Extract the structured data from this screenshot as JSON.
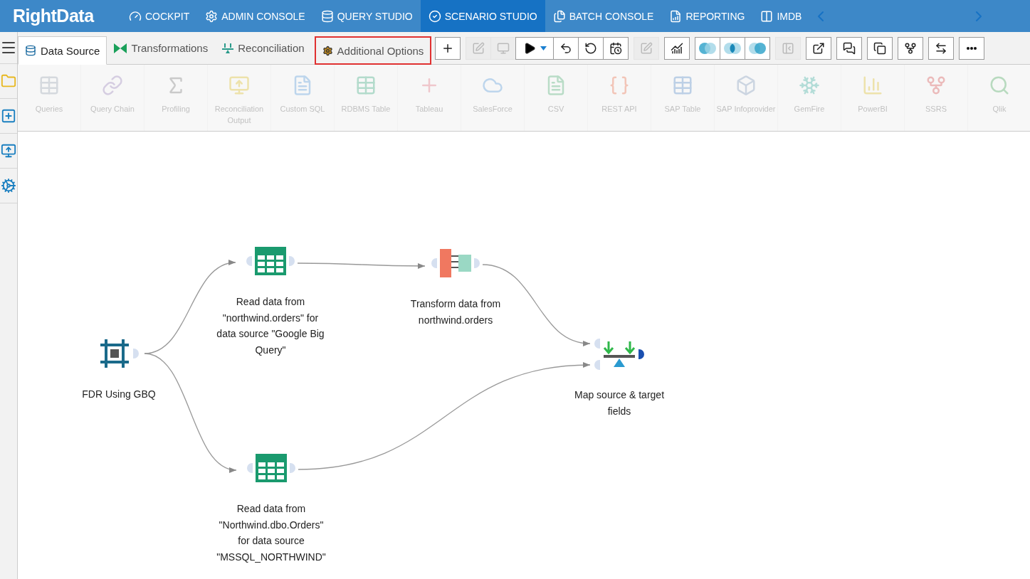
{
  "logo": "RightData",
  "nav": [
    {
      "label": "COCKPIT",
      "kind": "gauge",
      "selected": false
    },
    {
      "label": "ADMIN CONSOLE",
      "kind": "gear",
      "selected": false
    },
    {
      "label": "QUERY STUDIO",
      "kind": "database",
      "selected": false
    },
    {
      "label": "SCENARIO STUDIO",
      "kind": "scenario",
      "selected": true
    },
    {
      "label": "BATCH CONSOLE",
      "kind": "files",
      "selected": false
    },
    {
      "label": "REPORTING",
      "kind": "report",
      "selected": false
    },
    {
      "label": "IMDB",
      "kind": "columns",
      "selected": false
    }
  ],
  "tabs": [
    {
      "label": "Data Source",
      "kind": "source",
      "selected": true,
      "highlighted": false
    },
    {
      "label": "Transformations",
      "kind": "transform",
      "selected": false,
      "highlighted": false
    },
    {
      "label": "Reconciliation",
      "kind": "recon",
      "selected": false,
      "highlighted": false
    },
    {
      "label": "Additional Options",
      "kind": "options",
      "selected": false,
      "highlighted": true
    }
  ],
  "toolbar_groups": [
    [
      {
        "kind": "add",
        "disabled": false
      }
    ],
    [
      {
        "kind": "edit",
        "disabled": true
      },
      {
        "kind": "monitor",
        "disabled": true
      },
      {
        "kind": "run",
        "disabled": false
      },
      {
        "kind": "undo",
        "disabled": false
      },
      {
        "kind": "history",
        "disabled": false
      },
      {
        "kind": "schedule",
        "disabled": false
      }
    ],
    [
      {
        "kind": "edit",
        "disabled": true
      }
    ],
    [
      {
        "kind": "chart",
        "disabled": false
      }
    ],
    [
      {
        "kind": "venn-left",
        "disabled": false
      },
      {
        "kind": "venn-inner",
        "disabled": false
      },
      {
        "kind": "venn-right",
        "disabled": false
      }
    ],
    [
      {
        "kind": "collapse",
        "disabled": true
      }
    ],
    [
      {
        "kind": "export",
        "disabled": false
      }
    ],
    [
      {
        "kind": "comment",
        "disabled": false
      }
    ],
    [
      {
        "kind": "copy",
        "disabled": false
      }
    ],
    [
      {
        "kind": "flow",
        "disabled": false
      }
    ],
    [
      {
        "kind": "compare",
        "disabled": false
      }
    ],
    [
      {
        "kind": "more",
        "disabled": false
      }
    ]
  ],
  "palette": [
    {
      "label": "Queries",
      "kind": "queries",
      "disabled": true
    },
    {
      "label": "Query Chain",
      "kind": "chain",
      "disabled": true
    },
    {
      "label": "Profiling",
      "kind": "profiling",
      "disabled": true
    },
    {
      "label": "Reconciliation Output",
      "kind": "recon",
      "disabled": true
    },
    {
      "label": "Custom SQL",
      "kind": "sql",
      "disabled": true
    },
    {
      "label": "RDBMS Table",
      "kind": "table",
      "disabled": true
    },
    {
      "label": "Tableau",
      "kind": "tableau",
      "disabled": true
    },
    {
      "label": "SalesForce",
      "kind": "cloud",
      "disabled": true
    },
    {
      "label": "CSV",
      "kind": "csv",
      "disabled": true
    },
    {
      "label": "REST API",
      "kind": "rest",
      "disabled": true
    },
    {
      "label": "SAP Table",
      "kind": "sap",
      "disabled": true
    },
    {
      "label": "SAP Infoprovider",
      "kind": "cube",
      "disabled": true
    },
    {
      "label": "GemFire",
      "kind": "gemfire",
      "disabled": true
    },
    {
      "label": "PowerBI",
      "kind": "powerbi",
      "disabled": true
    },
    {
      "label": "SSRS",
      "kind": "ssrs",
      "disabled": true
    },
    {
      "label": "Qlik",
      "kind": "qlik",
      "disabled": true
    }
  ],
  "sidebar": [
    {
      "kind": "folder"
    },
    {
      "kind": "add-source"
    },
    {
      "kind": "monitor"
    },
    {
      "kind": "settings"
    }
  ],
  "nodes": [
    {
      "label": "FDR Using GBQ",
      "kind": "start"
    },
    {
      "label": "Read data from \"northwind.orders\" for data source \"Google Big Query\"",
      "kind": "table"
    },
    {
      "label": "Transform data from northwind.orders",
      "kind": "transform"
    },
    {
      "label": "Map source & target fields",
      "kind": "map"
    },
    {
      "label": "Read data from \"Northwind.dbo.Orders\" for data source \"MSSQL_NORTHWIND\"",
      "kind": "table"
    }
  ]
}
